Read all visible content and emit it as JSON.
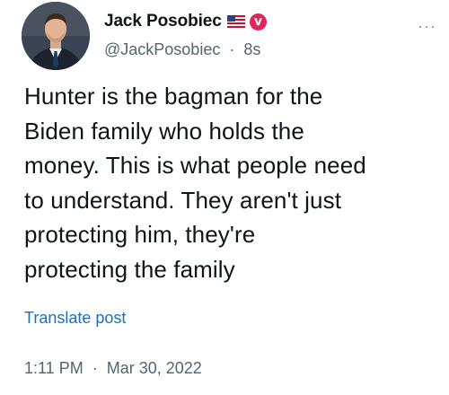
{
  "author": {
    "display_name": "Jack Posobiec",
    "handle": "@JackPosobiec",
    "separator": "·",
    "relative_time": "8s",
    "flag_icon": "us-flag-icon",
    "badge_icon": "verified-badge-icon",
    "badge_color": "#e0245e"
  },
  "more_icon": "···",
  "post": {
    "text": "Hunter is the bagman for the\nBiden family who holds the\nmoney. This is what people need\nto understand. They aren't just\nprotecting him, they're\nprotecting the family"
  },
  "translate_label": "Translate post",
  "meta": {
    "time": "1:11 PM",
    "separator": "·",
    "date": "Mar 30, 2022"
  },
  "colors": {
    "text_primary": "#0f1419",
    "text_secondary": "#536471",
    "link": "#1d6fb8"
  }
}
